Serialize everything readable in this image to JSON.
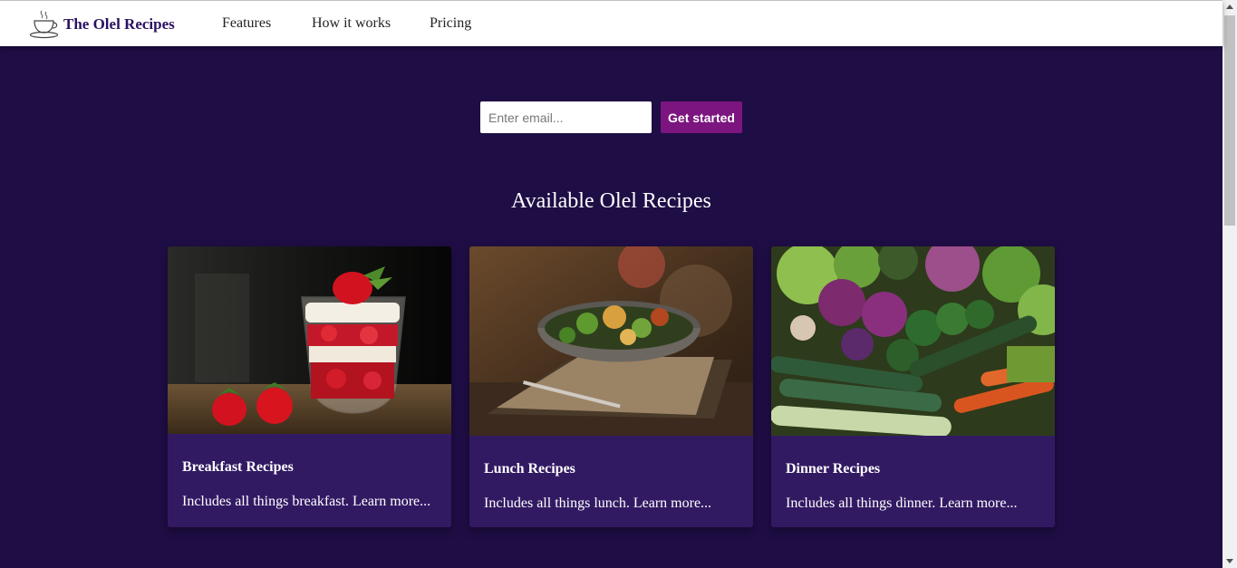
{
  "brand": {
    "name": "The Olel Recipes",
    "logo_icon": "teacup-logo-icon"
  },
  "nav": {
    "links": [
      "Features",
      "How it works",
      "Pricing"
    ]
  },
  "signup": {
    "email_placeholder": "Enter email...",
    "email_value": "",
    "button_label": "Get started"
  },
  "section": {
    "title": "Available Olel Recipes"
  },
  "cards": [
    {
      "title": "Breakfast Recipes",
      "text": "Includes all things breakfast. Learn more..."
    },
    {
      "title": "Lunch Recipes",
      "text": "Includes all things lunch. Learn more..."
    },
    {
      "title": "Dinner Recipes",
      "text": "Includes all things dinner. Learn more..."
    }
  ],
  "colors": {
    "background": "#1f0d45",
    "card": "#321a63",
    "accent": "#7c157f",
    "brand_text": "#2a1160"
  }
}
